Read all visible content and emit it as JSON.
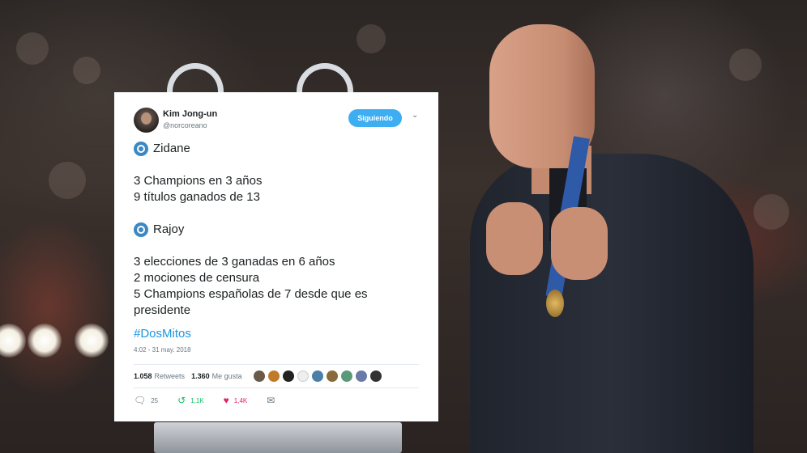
{
  "tweet": {
    "author_name": "Kim Jong-un",
    "author_handle": "@norcoreano",
    "follow_label": "Siguiendo",
    "chevron_icon": "chevron-down-icon",
    "section1_title": "Zidane",
    "section1_lines": [
      "3 Champions en 3 años",
      "9 títulos ganados de 13"
    ],
    "section2_title": "Rajoy",
    "section2_lines": [
      "3 elecciones de 3 ganadas en 6 años",
      "2 mociones de censura",
      "5 Champions españolas de 7 desde que es",
      "presidente"
    ],
    "hashtag": "#DosMitos",
    "timestamp": "4:02 - 31 may. 2018",
    "retweets_count": "1.058",
    "retweets_label": "Retweets",
    "likes_count": "1.360",
    "likes_label": "Me gusta",
    "reply_count": "25",
    "retweet_action_count": "1,1K",
    "like_action_count": "1,4K"
  },
  "colors": {
    "accent": "#1da1f2",
    "hashtag": "#1b95e0",
    "retweet": "#17bf63",
    "like": "#e0245e",
    "radio": "#3b88c3"
  }
}
